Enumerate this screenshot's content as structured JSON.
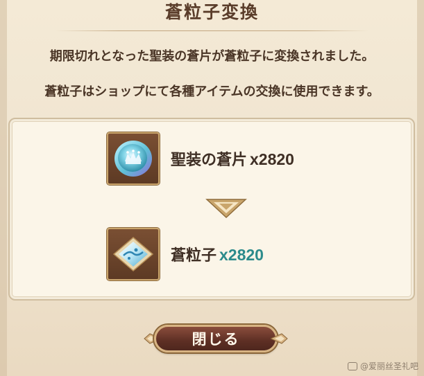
{
  "dialog": {
    "title": "蒼粒子変換",
    "description_line1": "期限切れとなった聖装の蒼片が蒼粒子に変換されました。",
    "description_line2": "蒼粒子はショップにて各種アイテムの交換に使用できます。"
  },
  "conversion": {
    "from": {
      "name": "聖装の蒼片",
      "quantity": "x2820",
      "icon": "holy-shard-coin-icon"
    },
    "arrow_icon": "down-arrow-icon",
    "to": {
      "name": "蒼粒子",
      "quantity": "x2820",
      "icon": "blue-particle-icon"
    }
  },
  "actions": {
    "close_label": "閉じる"
  },
  "watermark": {
    "text": "@爱丽丝圣礼吧"
  },
  "colors": {
    "title_text": "#5a3d2a",
    "body_text": "#4a3526",
    "quantity_accent": "#2c8b8b",
    "button_fill": "#5e2f24",
    "button_border": "#d8b483"
  }
}
